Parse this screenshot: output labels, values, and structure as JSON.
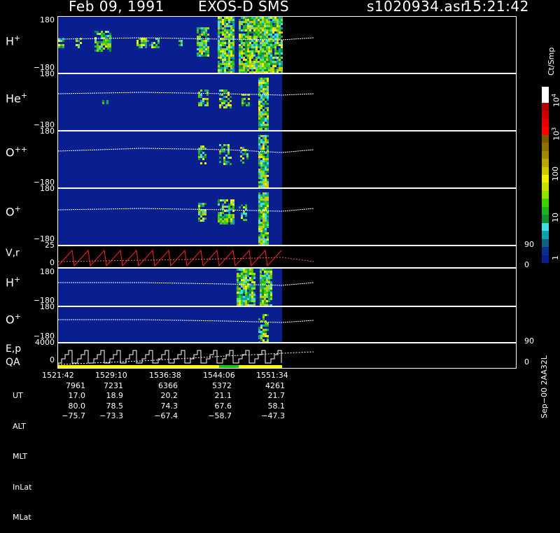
{
  "header": {
    "date": "Feb 09, 1991",
    "instrument": "EXOS-D SMS",
    "file": "s1020934.asr",
    "time": "15:21:42"
  },
  "panels": [
    {
      "label": "H",
      "sup": "+",
      "ytop": "180",
      "ybot": "−180"
    },
    {
      "label": "He",
      "sup": "+",
      "ytop": "180",
      "ybot": "−180"
    },
    {
      "label": "O",
      "sup": "++",
      "ytop": "180",
      "ybot": "−180"
    },
    {
      "label": "O",
      "sup": "+",
      "ytop": "180",
      "ybot": "−180"
    }
  ],
  "vr_panel": {
    "label": "V,r",
    "ytop": "25",
    "ybot": "0",
    "rtop": "90",
    "rbot": "0"
  },
  "lower_panels": [
    {
      "label": "H",
      "sup": "+",
      "ytop": "180",
      "ybot": "−180"
    },
    {
      "label": "O",
      "sup": "+",
      "ytop": "180",
      "ybot": "−180"
    }
  ],
  "ep_panel": {
    "label1": "E,p",
    "label2": "QA",
    "ytop": "4000",
    "ybot": "0",
    "rtop": "90",
    "rbot": "0"
  },
  "colorbar": {
    "units": "Ct/Smp",
    "ticks": [
      "10",
      "10",
      "100",
      "10",
      "1"
    ],
    "tick_sups": [
      "4",
      "3",
      "",
      "",
      ""
    ],
    "colors": [
      "#ffffff",
      "#ffffff",
      "#b30000",
      "#cc0000",
      "#e60000",
      "#ff0000",
      "#7a5a00",
      "#8c7000",
      "#a08a00",
      "#b8a800",
      "#d0c800",
      "#f0f000",
      "#c8e000",
      "#90e000",
      "#40d000",
      "#20b020",
      "#109030",
      "#40e0e0",
      "#10a0b0",
      "#106080",
      "#0a3090",
      "#0a1f8f"
    ]
  },
  "footer": {
    "row_labels": [
      "UT",
      "ALT",
      "MLT",
      "InLat",
      "MLat"
    ],
    "columns": [
      [
        "1521:42",
        "7961",
        "17.0",
        "80.0",
        "−75.7"
      ],
      [
        "1529:10",
        "7231",
        "18.9",
        "78.5",
        "−73.3"
      ],
      [
        "1536:38",
        "6366",
        "20.2",
        "74.3",
        "−67.4"
      ],
      [
        "1544:06",
        "5372",
        "21.1",
        "67.6",
        "−58.7"
      ],
      [
        "1551:34",
        "4261",
        "21.7",
        "58.1",
        "−47.3"
      ]
    ],
    "side_label": "Sep−00 2AA32L"
  },
  "chart_data": {
    "type": "heatmap",
    "title": "Feb 09, 1991 EXOS-D SMS",
    "x": [
      "1521:42",
      "1529:10",
      "1536:38",
      "1544:06",
      "1551:34"
    ],
    "series": [
      {
        "name": "H+",
        "ylim": [
          -180,
          180
        ]
      },
      {
        "name": "He+",
        "ylim": [
          -180,
          180
        ]
      },
      {
        "name": "O++",
        "ylim": [
          -180,
          180
        ]
      },
      {
        "name": "O+",
        "ylim": [
          -180,
          180
        ]
      },
      {
        "name": "V,r",
        "ylim": [
          0,
          25
        ]
      },
      {
        "name": "H+",
        "ylim": [
          -180,
          180
        ]
      },
      {
        "name": "O+",
        "ylim": [
          -180,
          180
        ]
      },
      {
        "name": "E,p",
        "ylim": [
          0,
          4000
        ]
      }
    ],
    "colorbar_units": "Ct/Smp"
  }
}
